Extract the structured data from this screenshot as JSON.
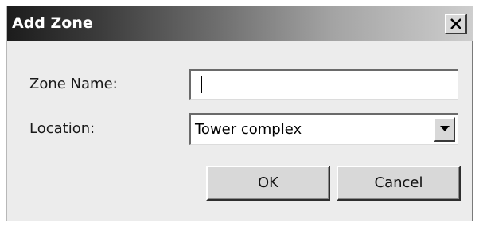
{
  "window": {
    "title": "Add Zone",
    "close_icon": "close-icon"
  },
  "form": {
    "zone_name_label": "Zone Name:",
    "zone_name_value": "",
    "location_label": "Location:",
    "location_value": "Tower complex",
    "location_dropdown_icon": "chevron-down-icon"
  },
  "buttons": {
    "ok_label": "OK",
    "cancel_label": "Cancel"
  },
  "colors": {
    "dialog_background": "#ececec",
    "titlebar_start": "#1c1c1c",
    "titlebar_end": "#cecece",
    "title_text": "#ffffff"
  }
}
